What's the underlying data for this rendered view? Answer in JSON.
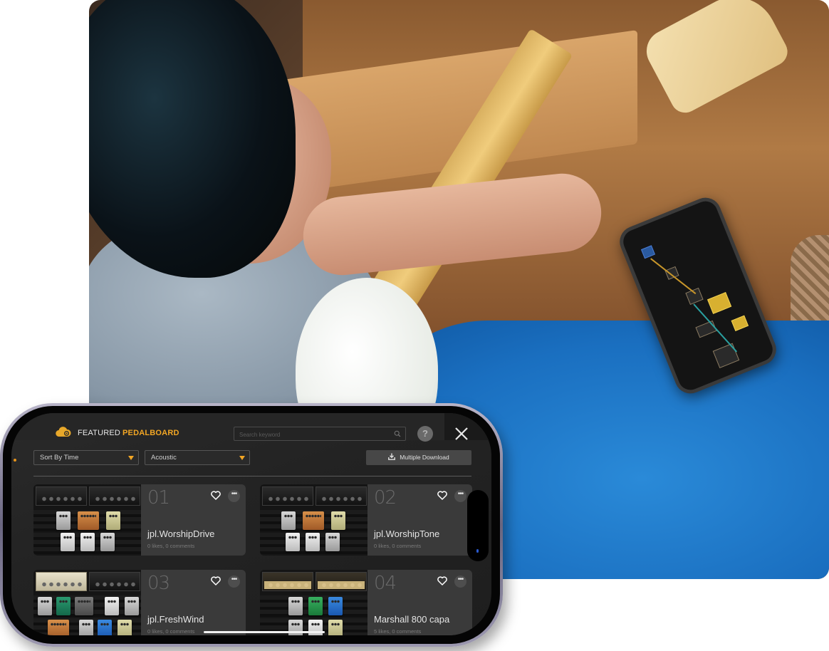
{
  "app": {
    "nav": {
      "featured": "FEATURED",
      "pedalboard": "PEDALBOARD",
      "active": "PEDALBOARD"
    },
    "search": {
      "placeholder": "Search keyword",
      "value": ""
    },
    "help_label": "?",
    "filters": {
      "sort": {
        "selected": "Sort By Time"
      },
      "genre": {
        "selected": "Acoustic"
      }
    },
    "multiple_download_label": "Multiple Download",
    "presets": [
      {
        "number": "01",
        "title": "jpl.WorshipDrive",
        "meta": "0 likes, 0 comments"
      },
      {
        "number": "02",
        "title": "jpl.WorshipTone",
        "meta": "0 likes, 0 comments"
      },
      {
        "number": "03",
        "title": "jpl.FreshWind",
        "meta": "0 likes, 0 comments"
      },
      {
        "number": "04",
        "title": "Marshall 800 capa",
        "meta": "5 likes, 0 comments"
      }
    ],
    "more_label": "•••"
  },
  "icons": {
    "logo": "cloud-logo-icon",
    "search": "search-icon",
    "help": "help-icon",
    "close": "close-icon",
    "download": "download-icon",
    "heart": "heart-icon",
    "more": "more-icon",
    "caret": "caret-down-icon"
  },
  "colors": {
    "accent": "#f2a624",
    "background": "#232323",
    "card": "#3a3a3a",
    "text": "#e4e4e4",
    "muted": "#7a7a7a"
  }
}
